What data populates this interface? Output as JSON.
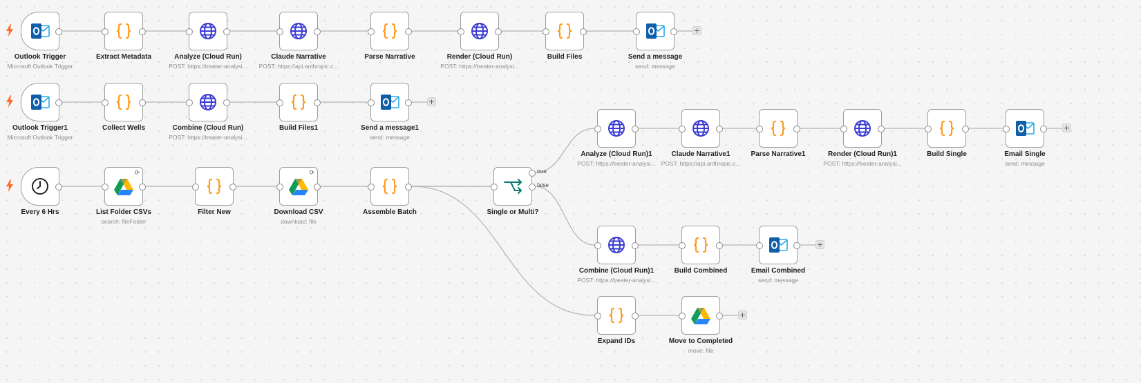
{
  "rows": [
    {
      "id": "row1",
      "nodes": [
        {
          "name": "Outlook Trigger",
          "sub": "Microsoft Outlook Trigger",
          "icon": "outlook-icon",
          "trigger": true
        },
        {
          "name": "Extract Metadata",
          "sub": "",
          "icon": "code-icon"
        },
        {
          "name": "Analyze (Cloud Run)",
          "sub": "POST: https://treater-analysi...",
          "icon": "globe-icon"
        },
        {
          "name": "Claude Narrative",
          "sub": "POST: https://api.anthropic.c...",
          "icon": "globe-icon"
        },
        {
          "name": "Parse Narrative",
          "sub": "",
          "icon": "code-icon"
        },
        {
          "name": "Render (Cloud Run)",
          "sub": "POST: https://treater-analysi...",
          "icon": "globe-icon"
        },
        {
          "name": "Build Files",
          "sub": "",
          "icon": "code-icon"
        },
        {
          "name": "Send a message",
          "sub": "send: message",
          "icon": "outlook-icon",
          "end": true
        }
      ]
    },
    {
      "id": "row2",
      "nodes": [
        {
          "name": "Outlook Trigger1",
          "sub": "Microsoft Outlook Trigger",
          "icon": "outlook-icon",
          "trigger": true
        },
        {
          "name": "Collect Wells",
          "sub": "",
          "icon": "code-icon"
        },
        {
          "name": "Combine (Cloud Run)",
          "sub": "POST: https://treater-analysi...",
          "icon": "globe-icon"
        },
        {
          "name": "Build Files1",
          "sub": "",
          "icon": "code-icon"
        },
        {
          "name": "Send a message1",
          "sub": "send: message",
          "icon": "outlook-icon",
          "end": true
        }
      ]
    },
    {
      "id": "row3",
      "nodes": [
        {
          "name": "Every 6 Hrs",
          "sub": "",
          "icon": "clock-icon",
          "trigger": true
        },
        {
          "name": "List Folder CSVs",
          "sub": "search: fileFolder",
          "icon": "google-drive-icon",
          "sync": true
        },
        {
          "name": "Filter New",
          "sub": "",
          "icon": "code-icon"
        },
        {
          "name": "Download CSV",
          "sub": "download: file",
          "icon": "google-drive-icon",
          "sync": true
        },
        {
          "name": "Assemble Batch",
          "sub": "",
          "icon": "code-icon"
        },
        {
          "name": "Single or Multi?",
          "sub": "",
          "icon": "switch-icon",
          "branch": true
        }
      ]
    },
    {
      "id": "single",
      "nodes": [
        {
          "name": "Analyze (Cloud Run)1",
          "sub": "POST: https://treater-analysi...",
          "icon": "globe-icon"
        },
        {
          "name": "Claude Narrative1",
          "sub": "POST: https://api.anthropic.c...",
          "icon": "globe-icon"
        },
        {
          "name": "Parse Narrative1",
          "sub": "",
          "icon": "code-icon"
        },
        {
          "name": "Render (Cloud Run)1",
          "sub": "POST: https://treater-analysi...",
          "icon": "globe-icon"
        },
        {
          "name": "Build Single",
          "sub": "",
          "icon": "code-icon"
        },
        {
          "name": "Email Single",
          "sub": "send: message",
          "icon": "outlook-icon",
          "end": true
        }
      ]
    },
    {
      "id": "combined",
      "nodes": [
        {
          "name": "Combine (Cloud Run)1",
          "sub": "POST: https://treater-analysi...",
          "icon": "globe-icon"
        },
        {
          "name": "Build Combined",
          "sub": "",
          "icon": "code-icon"
        },
        {
          "name": "Email Combined",
          "sub": "send: message",
          "icon": "outlook-icon",
          "end": true
        }
      ]
    },
    {
      "id": "move",
      "nodes": [
        {
          "name": "Expand IDs",
          "sub": "",
          "icon": "code-icon"
        },
        {
          "name": "Move to Completed",
          "sub": "move: file",
          "icon": "google-drive-icon",
          "end": true
        }
      ]
    }
  ],
  "branch": {
    "true_label": "true",
    "false_label": "false"
  },
  "add_symbol": "+",
  "sync_symbol": "⟳",
  "colors": {
    "globe": "#3a3ad6",
    "code": "#ff9a1f",
    "outlook_dark": "#0f5ea8",
    "outlook_light": "#28a8ea",
    "trigger_bolt": "#ff6d2d",
    "switch": "#0a7a70",
    "edge": "#b3b3b3"
  }
}
